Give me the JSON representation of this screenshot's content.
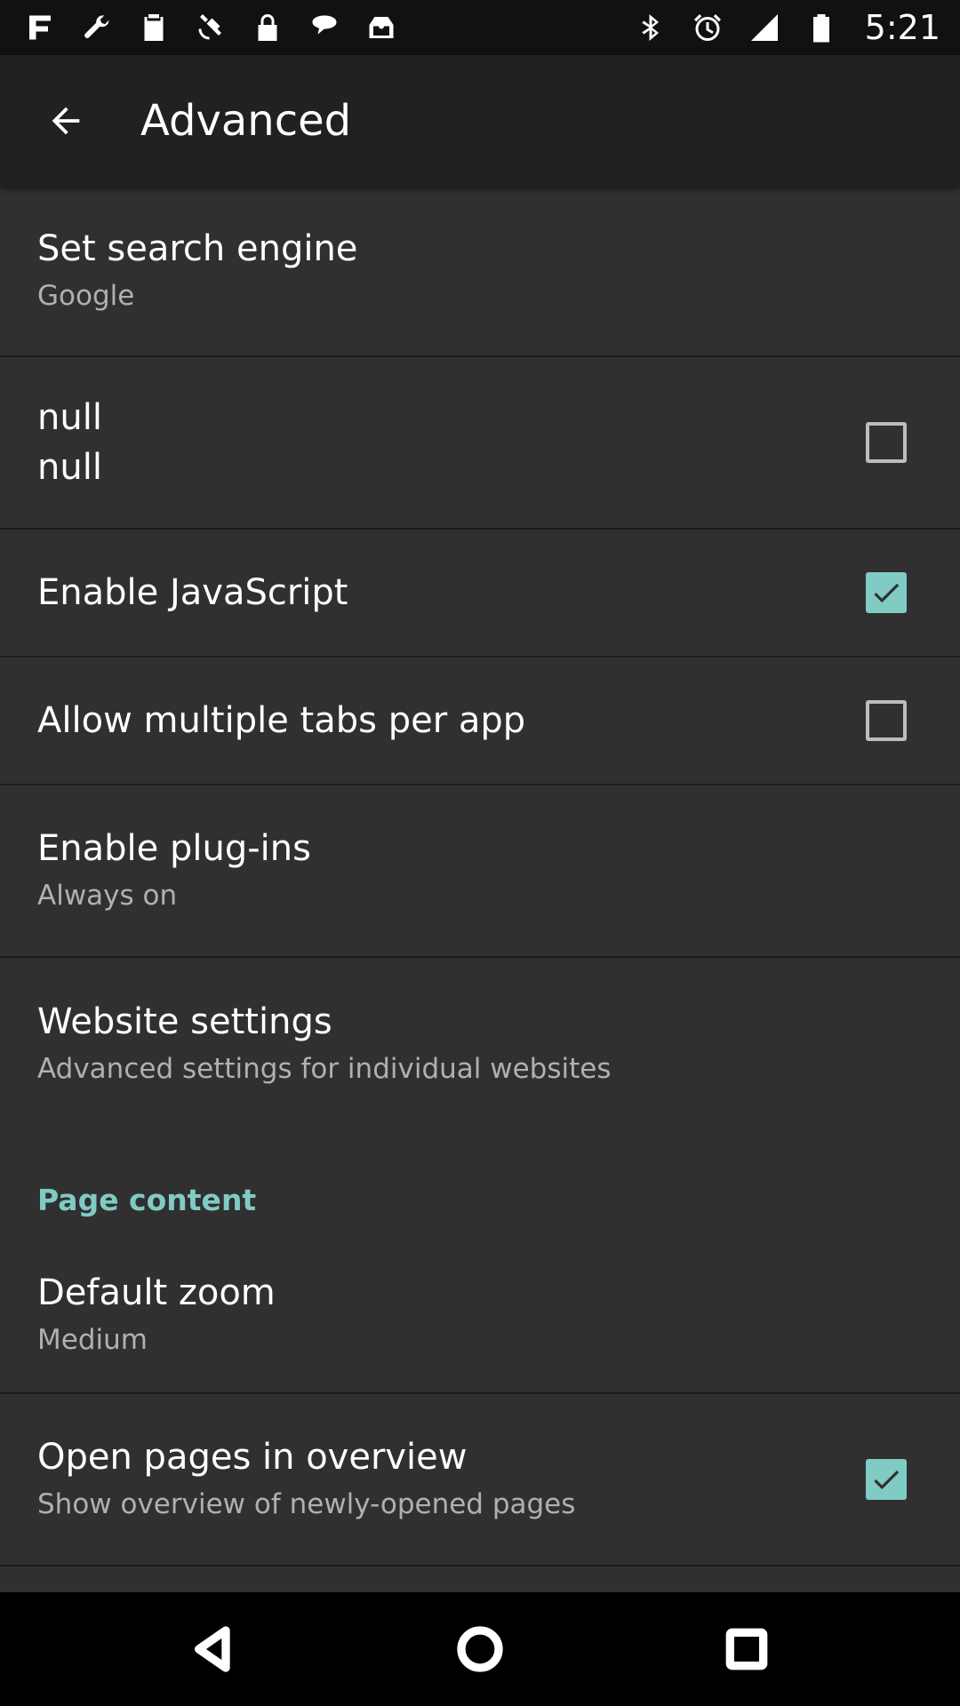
{
  "status_bar": {
    "time": "5:21",
    "left_icons": [
      "app-notification-icon",
      "wrench-icon",
      "clipboard-icon",
      "satellite-icon",
      "lock-icon",
      "message-icon",
      "inbox-icon"
    ],
    "right_icons": [
      "bluetooth-icon",
      "alarm-icon",
      "signal-icon",
      "battery-icon"
    ]
  },
  "app_bar": {
    "title": "Advanced"
  },
  "settings": {
    "search_engine": {
      "title": "Set search engine",
      "summary": "Google"
    },
    "null_setting": {
      "title": "null",
      "summary": "null",
      "checked": false
    },
    "javascript": {
      "title": "Enable JavaScript",
      "checked": true
    },
    "multiple_tabs": {
      "title": "Allow multiple tabs per app",
      "checked": false
    },
    "plugins": {
      "title": "Enable plug-ins",
      "summary": "Always on"
    },
    "website_settings": {
      "title": "Website settings",
      "summary": "Advanced settings for individual websites"
    },
    "page_content_header": "Page content",
    "default_zoom": {
      "title": "Default zoom",
      "summary": "Medium"
    },
    "overview": {
      "title": "Open pages in overview",
      "summary": "Show overview of newly-opened pages",
      "checked": true
    }
  },
  "colors": {
    "accent": "#80cbc4",
    "background": "#303030",
    "app_bar": "#212121",
    "status_bar": "#111111"
  },
  "nav_bar": {
    "icons": [
      "back-triangle-icon",
      "home-circle-icon",
      "recents-square-icon"
    ]
  }
}
